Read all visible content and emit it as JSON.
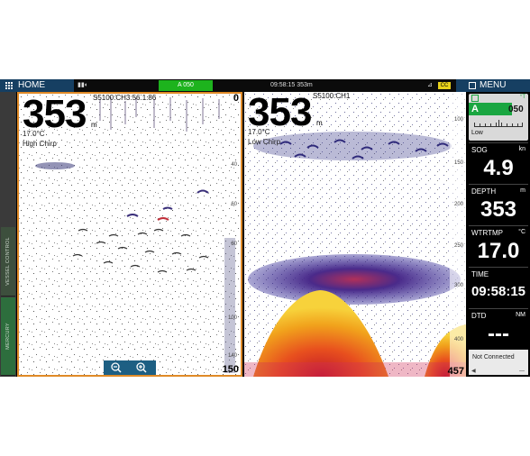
{
  "topbar": {
    "home_label": "HOME",
    "autopilot_label": "A 050",
    "clock": "09:58:15  353m",
    "battery_label": "CC"
  },
  "menu_label": "MENU",
  "sidebar": {
    "tabs": [
      {
        "label": "VESSEL CONTROL"
      },
      {
        "label": "MERCURY"
      }
    ]
  },
  "left_pane": {
    "depth": "353",
    "depth_unit": "m",
    "temperature": "17.0°C",
    "mode": "High Chirp",
    "channel": "S5100:CH3:56.1.86",
    "range_top": "0",
    "range_bottom": "150",
    "ticks": [
      "40",
      "60",
      "80",
      "100",
      "140"
    ]
  },
  "right_pane": {
    "depth": "353",
    "depth_unit": "m",
    "temperature": "17.0°C",
    "mode": "Low Chirp",
    "channel": "S5100:CH1",
    "range_bottom": "457",
    "ticks": [
      "100",
      "150",
      "200",
      "250",
      "300",
      "400"
    ]
  },
  "datapanel": {
    "autopilot": {
      "mode": "A",
      "heading": "050",
      "unit": "°T",
      "response": "Low"
    },
    "boxes": [
      {
        "label": "SOG",
        "unit": "kn",
        "value": "4.9"
      },
      {
        "label": "DEPTH",
        "unit": "m",
        "value": "353"
      },
      {
        "label": "WTRTMP",
        "unit": "°C",
        "value": "17.0"
      },
      {
        "label": "TIME",
        "unit": "",
        "value": "09:58:15"
      },
      {
        "label": "DTD",
        "unit": "NM",
        "value": "---"
      }
    ],
    "connection": "Not Connected"
  },
  "colors": {
    "accent_blue": "#163f62",
    "autopilot_green": "#1aa641",
    "pane_border": "#e08a27"
  },
  "icons": [
    "home-grid-icon",
    "menu-icon",
    "zoom-out-icon",
    "zoom-in-icon",
    "autopilot-icon",
    "gps-icon"
  ]
}
